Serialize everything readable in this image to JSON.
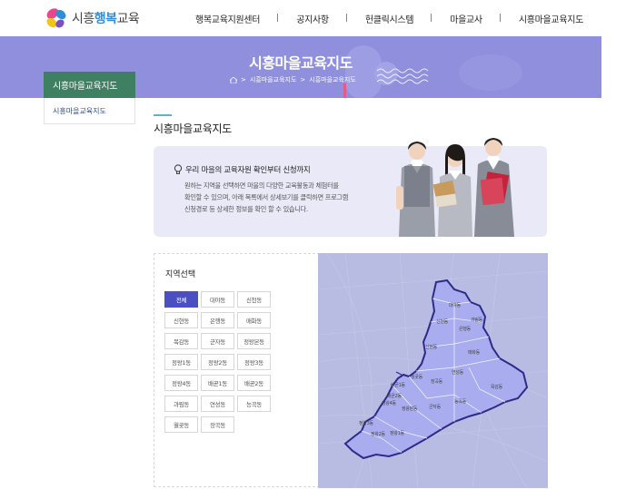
{
  "header": {
    "logo": {
      "prefix": "시흥",
      "highlight": "행복",
      "suffix": "교육"
    },
    "nav": [
      "행복교육지원센터",
      "공지사항",
      "헌클릭시스템",
      "마을교사",
      "시흥마을교육지도"
    ]
  },
  "visual": {
    "title": "시흥마을교육지도",
    "breadcrumb": [
      "시흥마을교육지도",
      "시흥마을교육지도"
    ]
  },
  "lnb": {
    "title": "시흥마을교육지도",
    "items": [
      "시흥마을교육지도"
    ]
  },
  "content": {
    "title": "시흥마을교육지도",
    "intro_heading": "우리 마을의 교육자원 확인부터 신청까지",
    "intro_lines": [
      "원하는 지역을 선택하면 마을의 다양한 교육활동과 체험터를",
      "확인할 수 있으며, 아래 목록에서 상세보기를 클릭하면 프로그램",
      "신청경로 등 상세한 정보를 확인 할 수 있습니다."
    ]
  },
  "region": {
    "title": "지역선택",
    "buttons": [
      "전체",
      "대야동",
      "신천동",
      "신현동",
      "은행동",
      "매화동",
      "목감동",
      "군자동",
      "정왕본동",
      "정왕1동",
      "정왕2동",
      "정왕3동",
      "정왕4동",
      "배곧1동",
      "배곧2동",
      "과림동",
      "연성동",
      "능곡동",
      "월곶동",
      "장곡동"
    ],
    "active_index": 0,
    "map_labels": [
      "대야동",
      "신천동",
      "과림동",
      "은행동",
      "신현동",
      "매화동",
      "월곶동",
      "장곡동",
      "연성동",
      "배곧1동",
      "배곧2동",
      "정왕4동",
      "정왕본동",
      "군자동",
      "능곡동",
      "목감동",
      "정왕3동",
      "정왕2동",
      "정왕1동"
    ]
  },
  "colors": {
    "banner": "#8f8fdd",
    "lnb_active": "#3f7f62",
    "button_active": "#4a4fc2",
    "map_region": "#a9adef"
  }
}
